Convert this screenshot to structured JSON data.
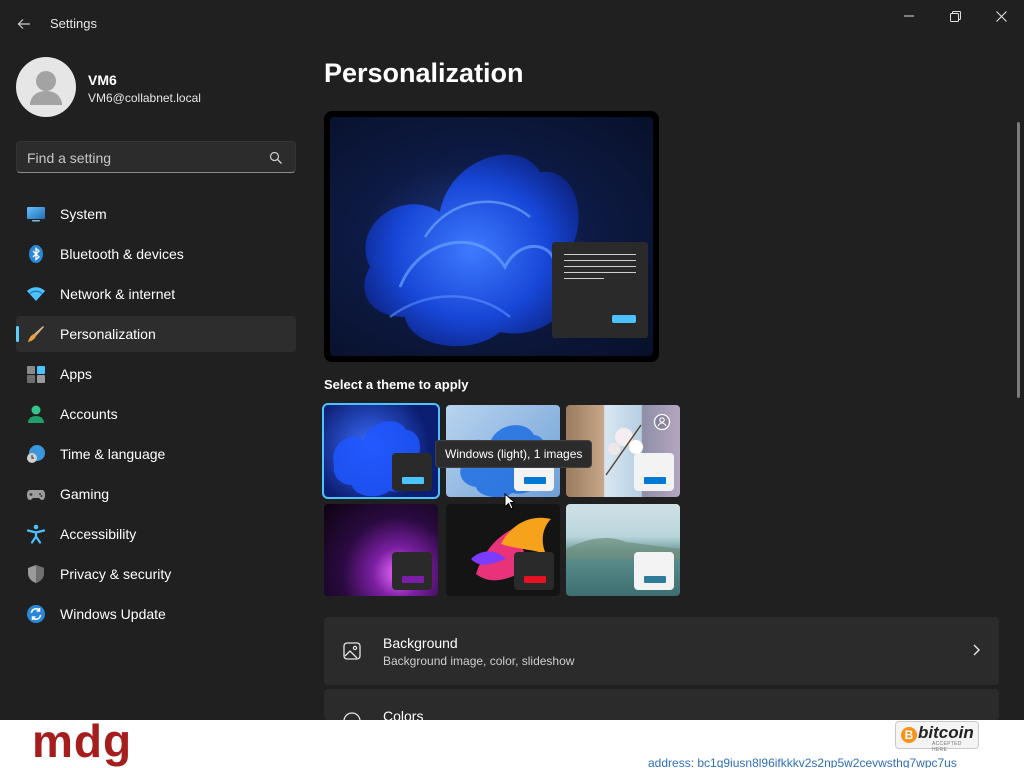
{
  "window": {
    "title": "Settings",
    "controls": [
      "minimize-icon",
      "restore-icon",
      "close-icon"
    ]
  },
  "user": {
    "name": "VM6",
    "email": "VM6@collabnet.local"
  },
  "search": {
    "placeholder": "Find a setting"
  },
  "sidebar": {
    "items": [
      {
        "label": "System",
        "icon": "system-icon"
      },
      {
        "label": "Bluetooth & devices",
        "icon": "bluetooth-icon"
      },
      {
        "label": "Network & internet",
        "icon": "wifi-icon"
      },
      {
        "label": "Personalization",
        "icon": "brush-icon",
        "active": true
      },
      {
        "label": "Apps",
        "icon": "apps-icon"
      },
      {
        "label": "Accounts",
        "icon": "accounts-icon"
      },
      {
        "label": "Time & language",
        "icon": "time-language-icon"
      },
      {
        "label": "Gaming",
        "icon": "gaming-icon"
      },
      {
        "label": "Accessibility",
        "icon": "accessibility-icon"
      },
      {
        "label": "Privacy & security",
        "icon": "shield-icon"
      },
      {
        "label": "Windows Update",
        "icon": "update-icon"
      }
    ]
  },
  "main": {
    "title": "Personalization",
    "themes_label": "Select a theme to apply",
    "themes": [
      {
        "id": "windows-dark",
        "selected": true
      },
      {
        "id": "windows-light",
        "tooltip": "Windows (light), 1 images"
      },
      {
        "id": "spotlight"
      },
      {
        "id": "glow"
      },
      {
        "id": "captured-motion"
      },
      {
        "id": "flow"
      }
    ],
    "tooltip": "Windows (light), 1 images",
    "cards": [
      {
        "title": "Background",
        "subtitle": "Background image, color, slideshow",
        "icon": "image-icon"
      },
      {
        "title": "Colors",
        "subtitle": "",
        "icon": "palette-icon"
      }
    ]
  },
  "colors": {
    "accent": "#60cdff",
    "background": "#202020",
    "card": "#2b2b2b"
  },
  "watermark": {
    "logo": "mdg",
    "badge_word": "bitcoin",
    "badge_small": "ACCEPTED HERE",
    "address": "address: bc1q9iusn8l96ifkkkv2s2np5w2cevwsthg7wpc7us"
  }
}
